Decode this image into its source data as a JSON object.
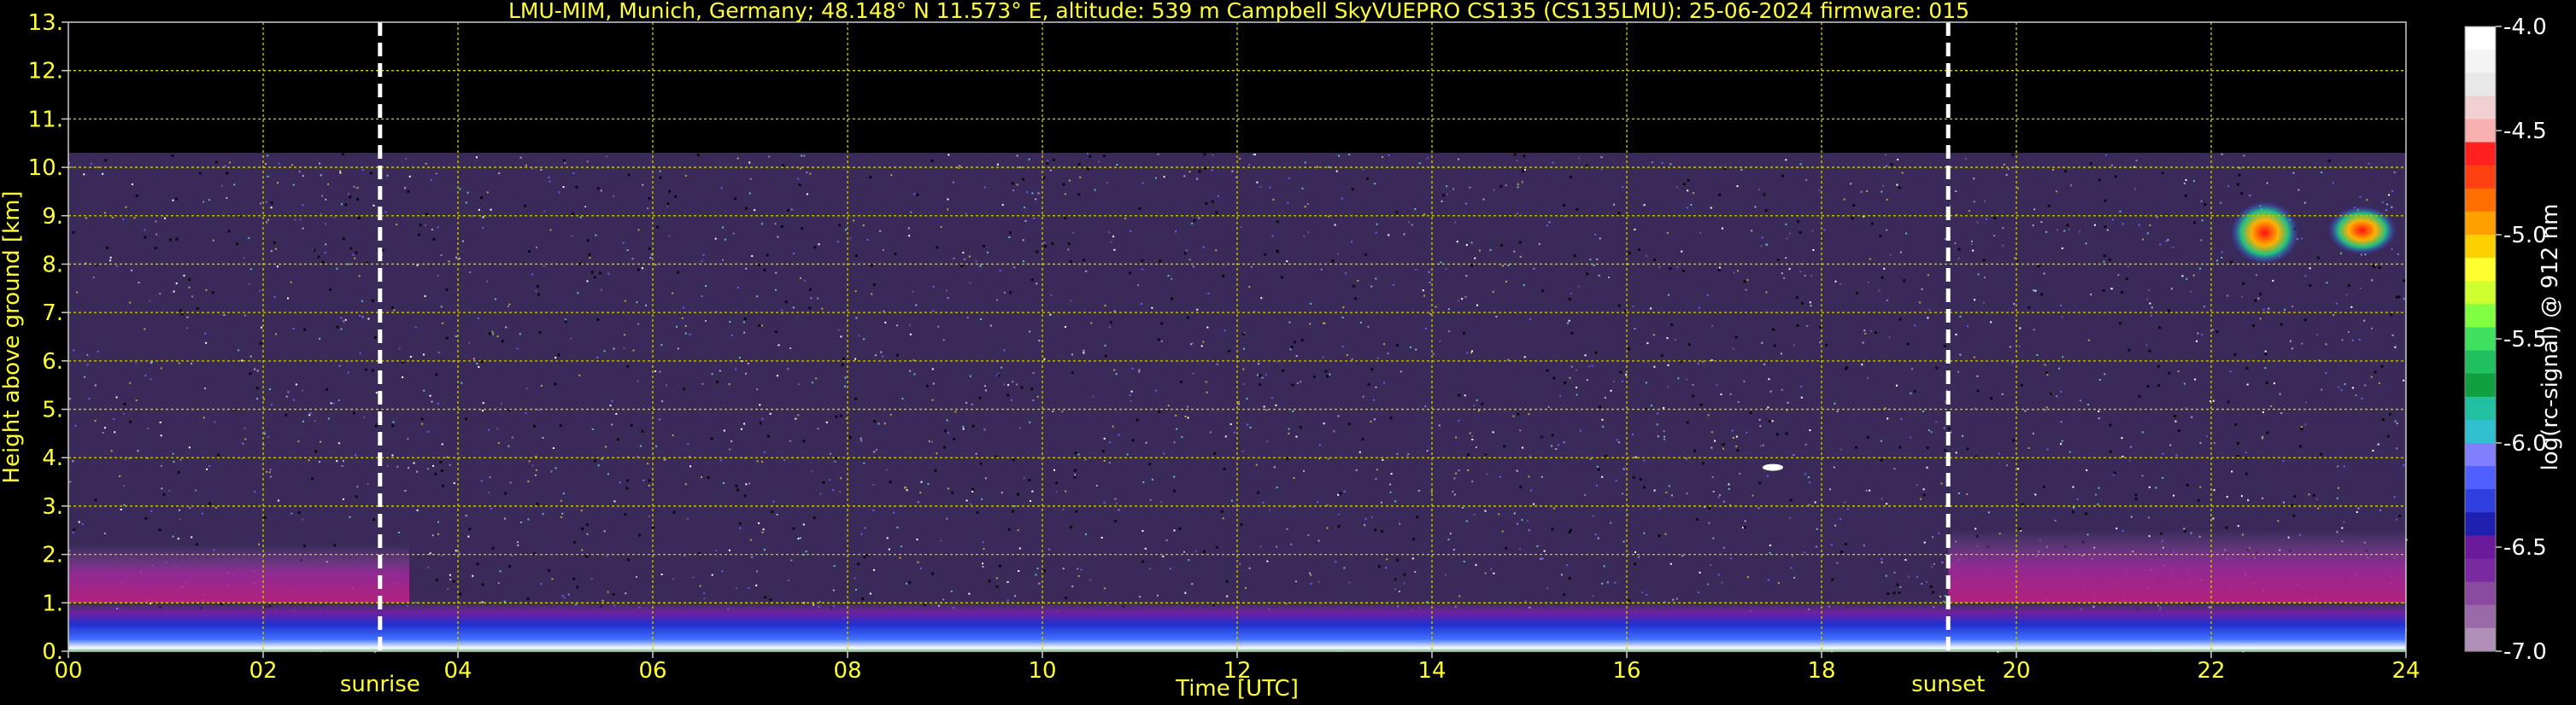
{
  "chart_data": {
    "type": "heatmap",
    "title": "LMU-MIM, Munich, Germany; 48.148° N 11.573° E, altitude: 539 m    Campbell SkyVUEPRO CS135 (CS135LMU): 25-06-2024    firmware: 015",
    "xlabel": "Time [UTC]",
    "ylabel": "Height above ground [km]",
    "xlim": [
      0,
      24
    ],
    "ylim": [
      0,
      13
    ],
    "x_ticks": [
      "00",
      "02",
      "04",
      "06",
      "08",
      "10",
      "12",
      "14",
      "16",
      "18",
      "20",
      "22",
      "24"
    ],
    "y_ticks": [
      "0.",
      "1.",
      "2.",
      "3.",
      "4.",
      "5.",
      "6.",
      "7.",
      "8.",
      "9.",
      "10.",
      "11.",
      "12.",
      "13."
    ],
    "grid": true,
    "markers": [
      {
        "label": "sunrise",
        "x": 3.2
      },
      {
        "label": "sunset",
        "x": 19.3
      }
    ],
    "colorbar": {
      "label": "log(rc-signal) @ 912 nm",
      "range": [
        -7.0,
        -4.0
      ],
      "ticks": [
        "-4.0",
        "-4.5",
        "-5.0",
        "-5.5",
        "-6.0",
        "-6.5",
        "-7.0"
      ]
    },
    "data_top_km": 10.3,
    "features": [
      {
        "kind": "boundary-layer",
        "x_range": [
          0,
          24
        ],
        "height_km": [
          0,
          1.0
        ]
      },
      {
        "kind": "residual-layer",
        "x_range": [
          0,
          3.5
        ],
        "height_km": [
          1.0,
          2.2
        ]
      },
      {
        "kind": "residual-layer",
        "x_range": [
          19.3,
          24
        ],
        "height_km": [
          1.0,
          2.5
        ]
      },
      {
        "kind": "cloud",
        "x_range": [
          22.2,
          22.9
        ],
        "height_km": [
          8.0,
          9.3
        ]
      },
      {
        "kind": "cloud",
        "x_range": [
          23.2,
          23.9
        ],
        "height_km": [
          8.2,
          9.2
        ]
      },
      {
        "kind": "point-echo",
        "x": 17.5,
        "height_km": 3.8
      }
    ]
  }
}
